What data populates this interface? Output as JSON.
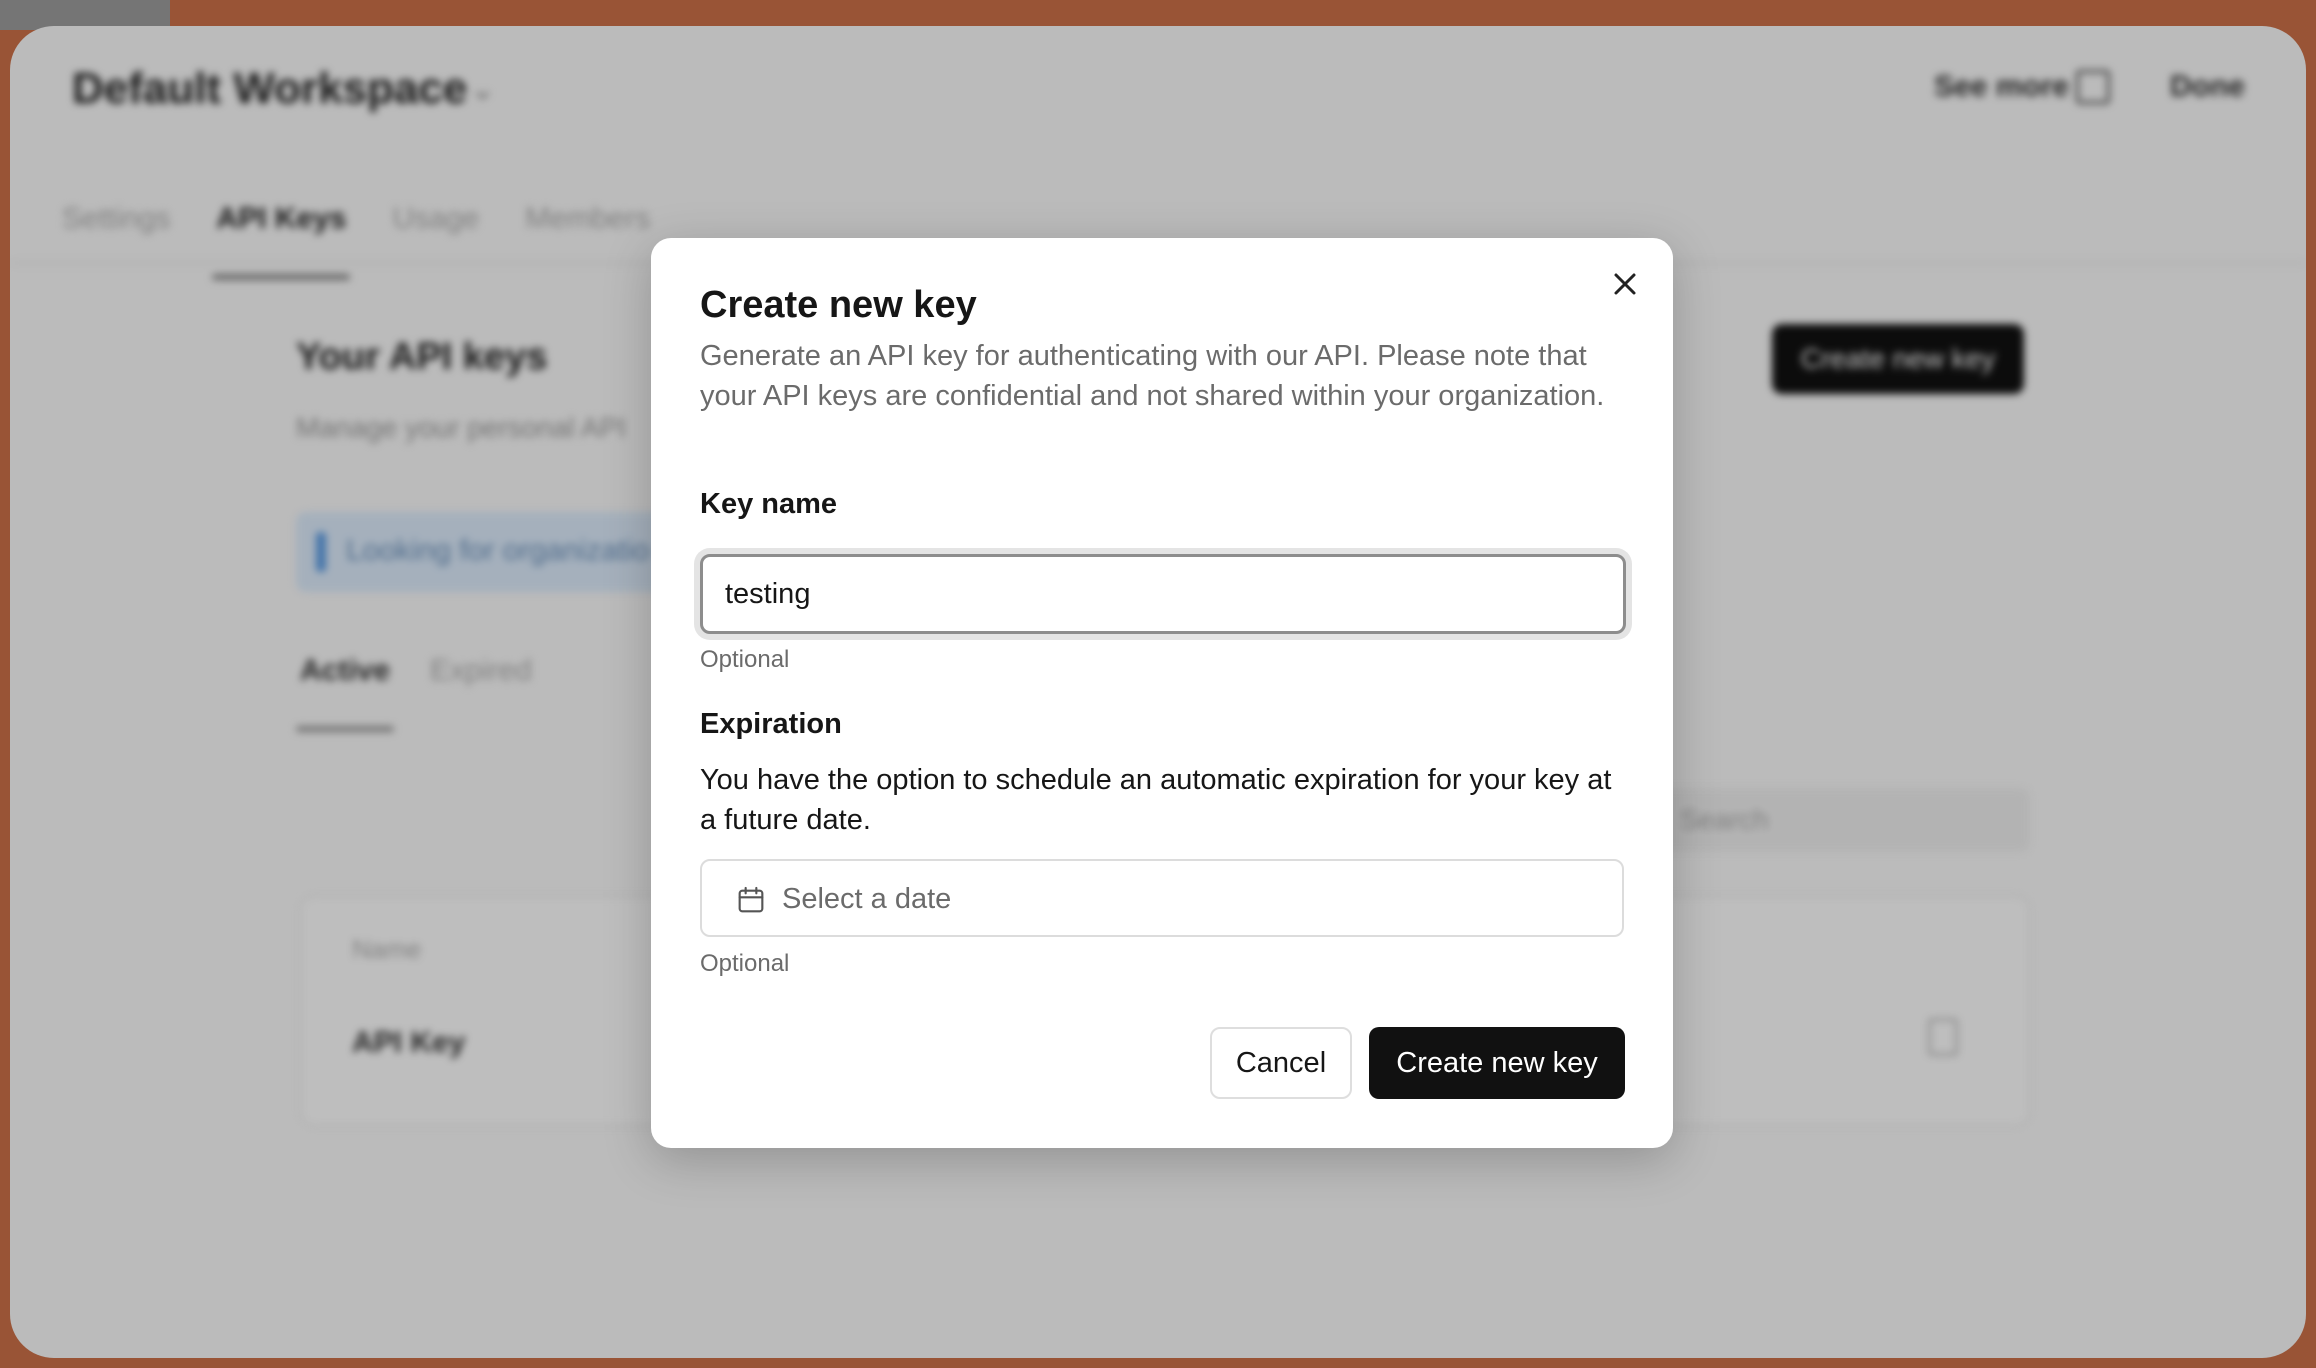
{
  "background": {
    "workspace_title": "Default Workspace",
    "see_more_label": "See more",
    "done_label": "Done",
    "tabs": [
      {
        "label": "Settings",
        "active": false
      },
      {
        "label": "API Keys",
        "active": true
      },
      {
        "label": "Usage",
        "active": false
      },
      {
        "label": "Members",
        "active": false
      }
    ],
    "section_title": "Your API keys",
    "section_desc": "Manage your personal API",
    "create_button_label": "Create new key",
    "info_text": "Looking for organizatio",
    "subtabs": [
      {
        "label": "Active",
        "active": true
      },
      {
        "label": "Expired",
        "active": false
      }
    ],
    "search_placeholder": "Search",
    "table_header_name": "Name",
    "table_row_name": "API Key"
  },
  "dialog": {
    "title": "Create new key",
    "description": "Generate an API key for authenticating with our API. Please note that your API keys are confidential and not shared within your organization.",
    "key_name_label": "Key name",
    "key_name_value": "testing",
    "key_name_hint": "Optional",
    "expiration_label": "Expiration",
    "expiration_description": "You have the option to schedule an automatic expiration for your key at a future date.",
    "date_placeholder": "Select a date",
    "date_hint": "Optional",
    "cancel_label": "Cancel",
    "submit_label": "Create new key",
    "close_icon": "close-icon",
    "calendar_icon": "calendar-icon"
  },
  "colors": {
    "primary_button": "#111111",
    "muted_text": "#6b6b6b",
    "wallpaper": "#c96f47"
  }
}
